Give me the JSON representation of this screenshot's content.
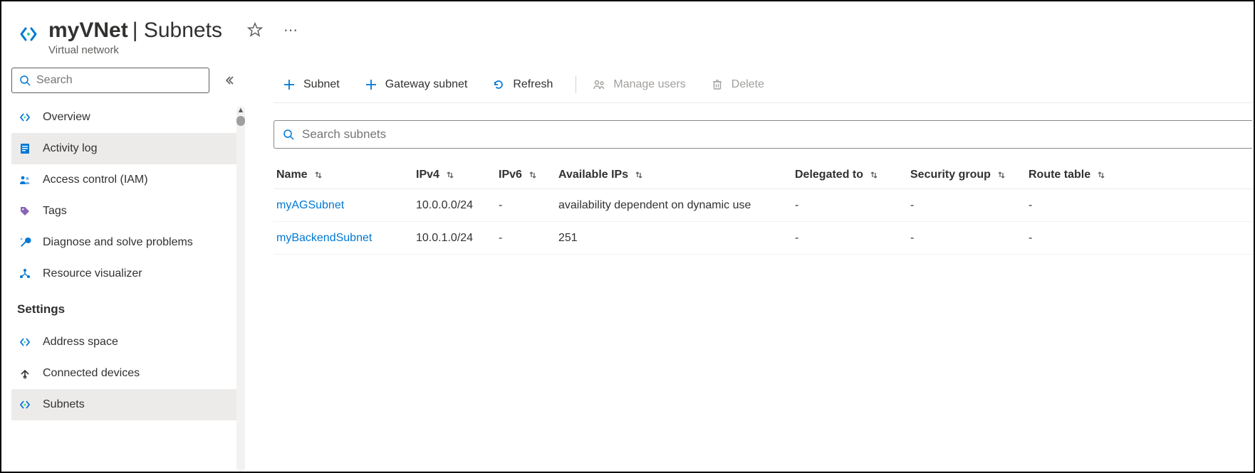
{
  "header": {
    "resource_name": "myVNet",
    "section": "Subnets",
    "resource_type": "Virtual network"
  },
  "sidebar": {
    "search_placeholder": "Search",
    "items_primary": [
      {
        "label": "Overview",
        "icon": "vnet"
      },
      {
        "label": "Activity log",
        "icon": "log",
        "selected": true
      },
      {
        "label": "Access control (IAM)",
        "icon": "people"
      },
      {
        "label": "Tags",
        "icon": "tag"
      },
      {
        "label": "Diagnose and solve problems",
        "icon": "wrench"
      },
      {
        "label": "Resource visualizer",
        "icon": "tree"
      }
    ],
    "section_settings": "Settings",
    "items_settings": [
      {
        "label": "Address space",
        "icon": "vnet"
      },
      {
        "label": "Connected devices",
        "icon": "devices"
      },
      {
        "label": "Subnets",
        "icon": "vnet",
        "selected": true
      }
    ]
  },
  "toolbar": {
    "subnet": "Subnet",
    "gateway_subnet": "Gateway subnet",
    "refresh": "Refresh",
    "manage_users": "Manage users",
    "delete": "Delete"
  },
  "filter": {
    "placeholder": "Search subnets"
  },
  "table": {
    "columns": {
      "name": "Name",
      "ipv4": "IPv4",
      "ipv6": "IPv6",
      "available": "Available IPs",
      "delegated": "Delegated to",
      "security": "Security group",
      "route": "Route table"
    },
    "rows": [
      {
        "name": "myAGSubnet",
        "ipv4": "10.0.0.0/24",
        "ipv6": "-",
        "available": "availability dependent on dynamic use",
        "delegated": "-",
        "security": "-",
        "route": "-"
      },
      {
        "name": "myBackendSubnet",
        "ipv4": "10.0.1.0/24",
        "ipv6": "-",
        "available": "251",
        "delegated": "-",
        "security": "-",
        "route": "-"
      }
    ]
  }
}
